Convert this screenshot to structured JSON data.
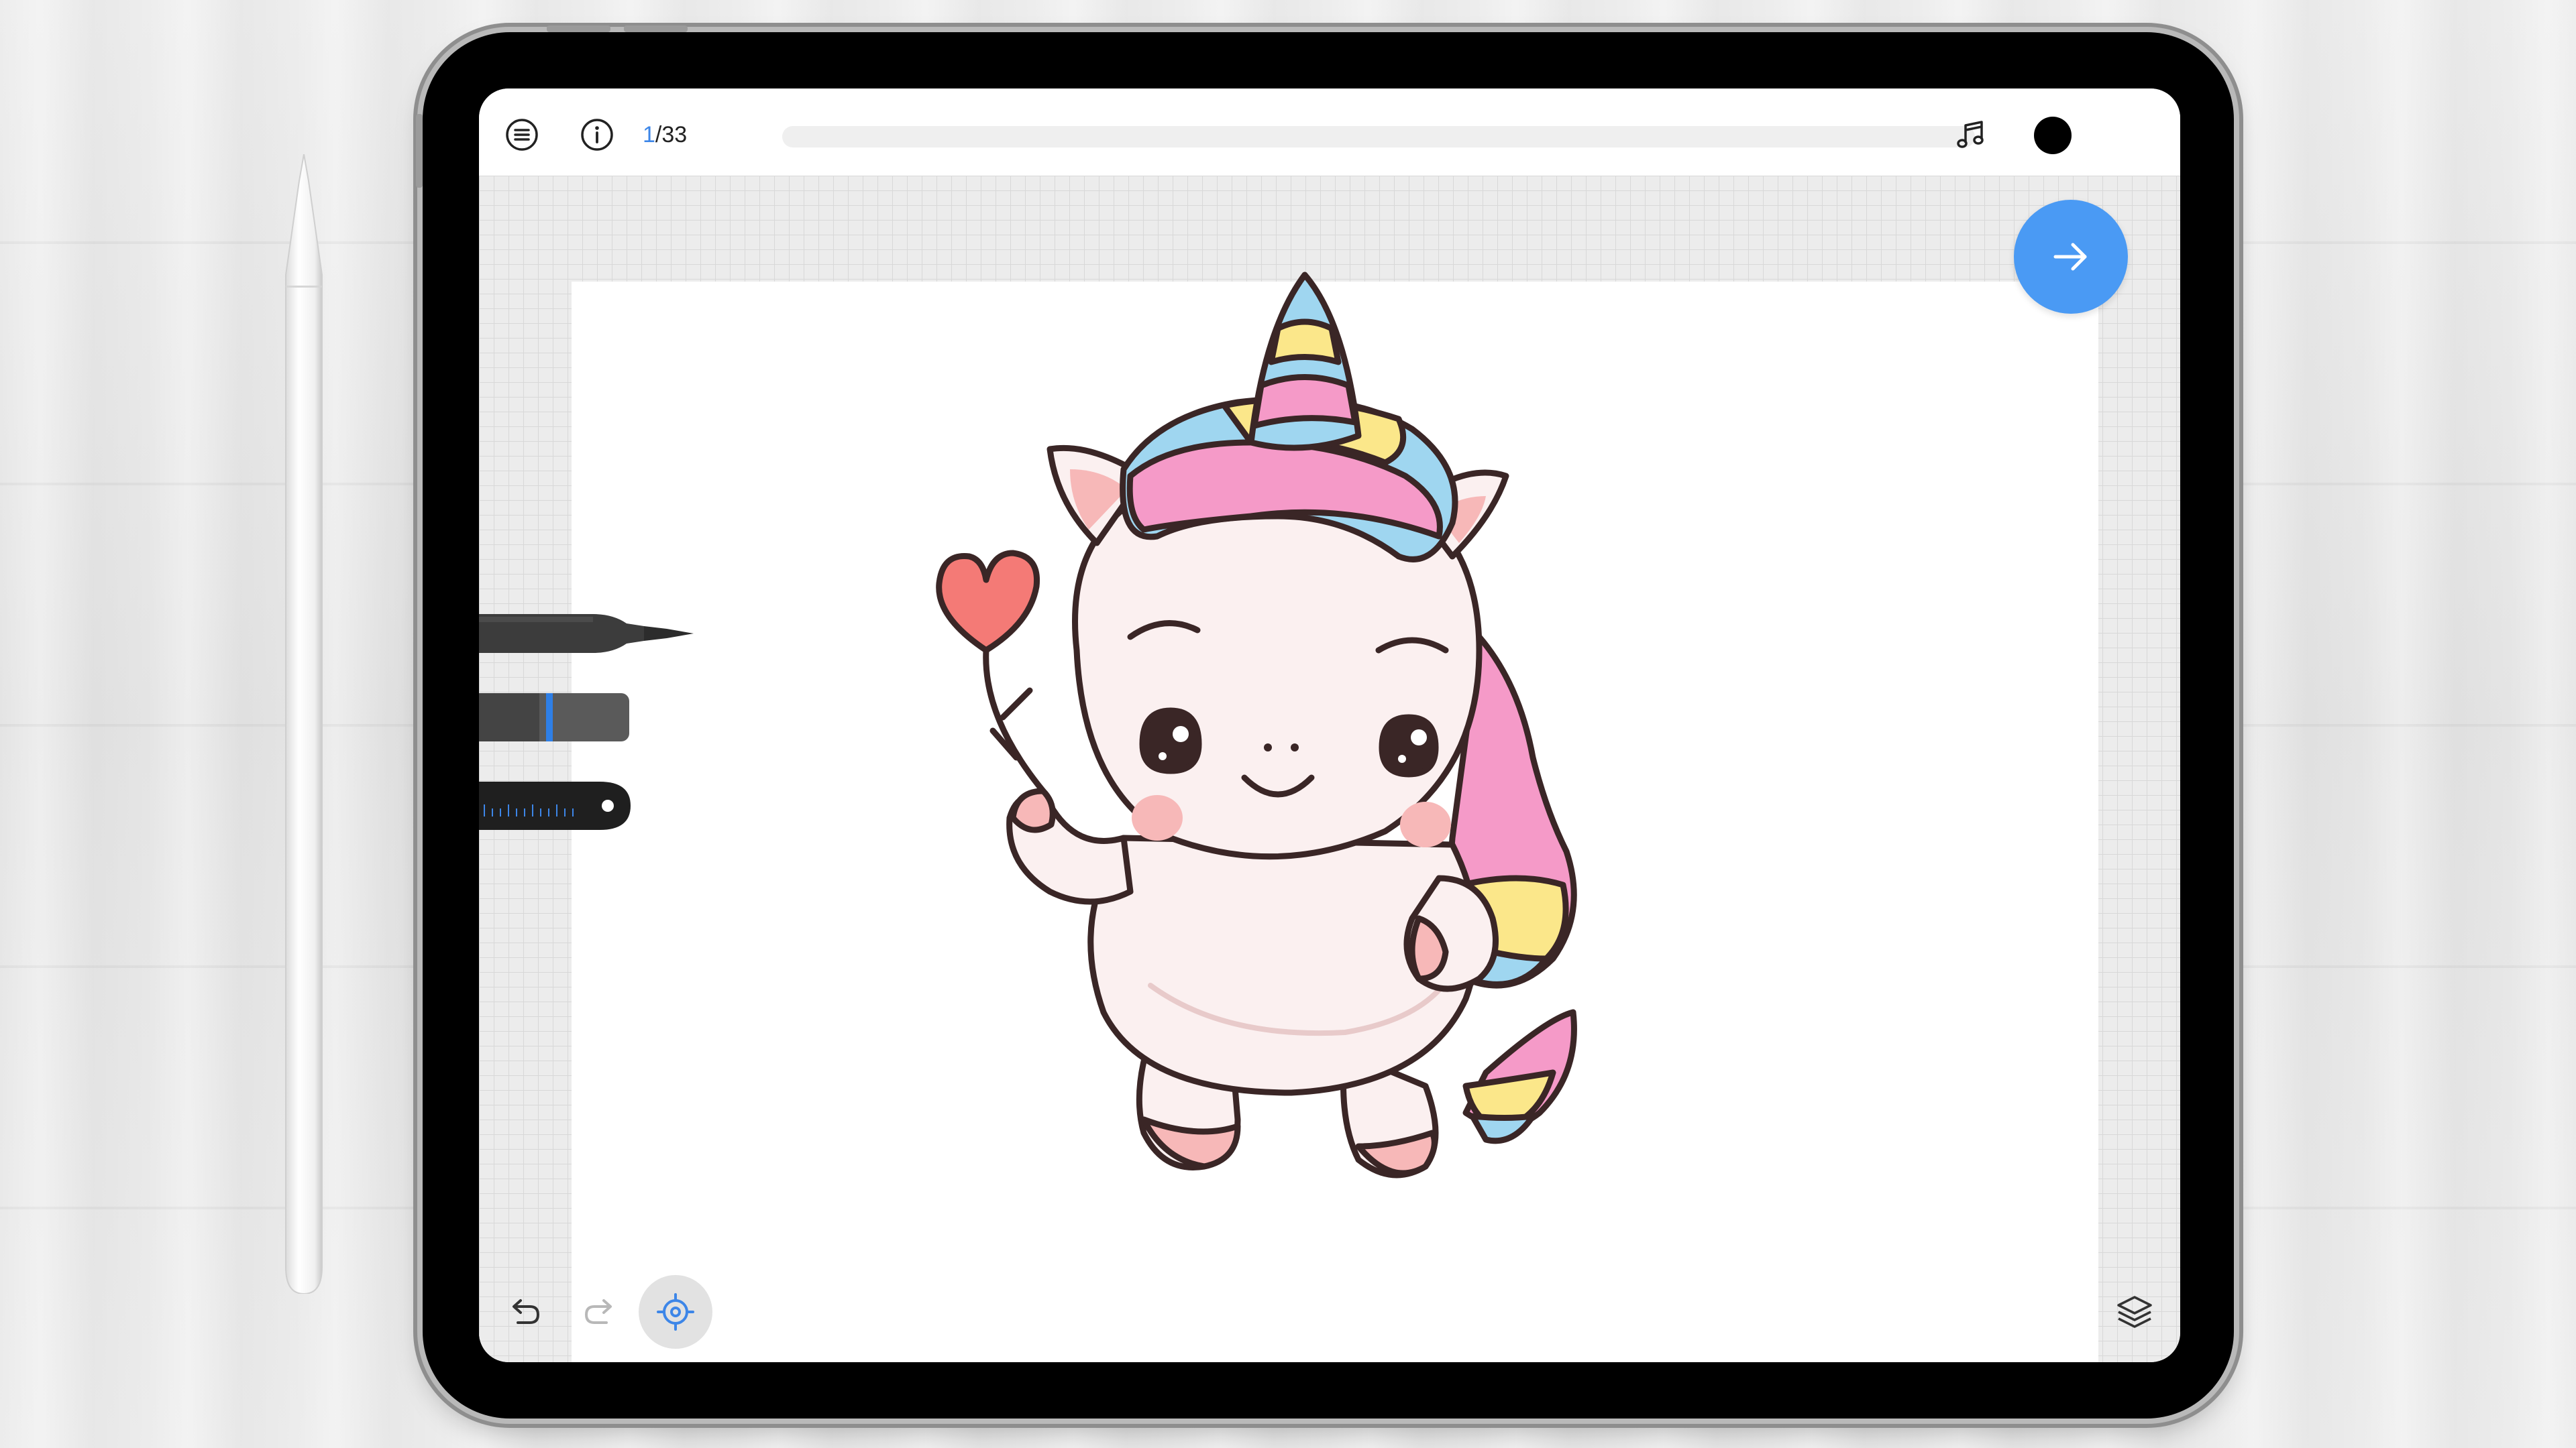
{
  "app": {
    "page_counter": {
      "current": "1",
      "total": "/33"
    },
    "progress_fraction": 0.0
  },
  "toolbar": {
    "menu_icon": "menu-icon",
    "info_icon": "info-icon",
    "music_icon": "music-note-icon",
    "color_swatch": "#000000"
  },
  "canvas": {
    "artwork": "unicorn-illustration",
    "next_icon": "arrow-right-icon",
    "accent_color": "#4a9af4"
  },
  "side_tools": [
    "marker-pen-icon",
    "eraser-icon",
    "ruler-icon"
  ],
  "bottom_tools": [
    "undo-icon",
    "redo-icon",
    "recenter-icon",
    "layers-icon"
  ]
}
